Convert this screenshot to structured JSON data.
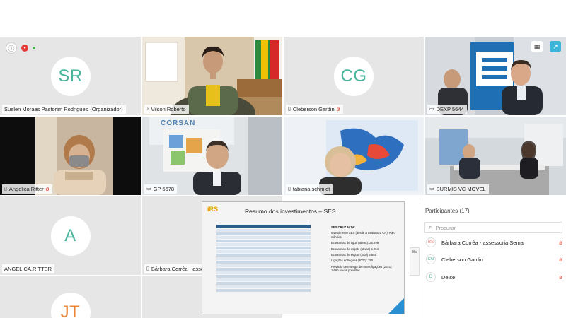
{
  "participants_grid": [
    {
      "initials": "SR",
      "name": "Suelen Moraes Pastorim Rodrigues",
      "role": "(Organizador)"
    },
    {
      "name": "Vilson Roberto"
    },
    {
      "initials": "CG",
      "name": "Cleberson Gardin"
    },
    {
      "name": "DEXP 5644"
    },
    {
      "name": "Angelica Ritter"
    },
    {
      "name": "GP 5678"
    },
    {
      "name": "fabiana.schmidt"
    },
    {
      "name": "SURMIS VC MOVEL"
    },
    {
      "initials": "A",
      "name": "ANGELICA.RITTER"
    },
    {
      "name": "Bárbara Corrêa - asses"
    },
    {
      "initials": "JT"
    }
  ],
  "wall_sign": "CORSAN",
  "slide": {
    "logo_main": "iRS",
    "title": "Resumo dos investimentos – SES",
    "heading": "SES CRUZ ALTA:",
    "lines": [
      "Investimento SES (desde a assinatura CP):  R$ 0 milhões.",
      "Economias de água (ativas): 25.299",
      "Economias de esgoto (ativas) 5.264",
      "Economias de esgoto (total) 5.655",
      "Ligações entregues (2020): 250",
      "Previsão de entrega de novas ligações (2021): 1.660 novas previstas."
    ]
  },
  "panel": {
    "title": "Participantes (17)",
    "search_placeholder": "Procurar",
    "items": [
      {
        "initials": "BS",
        "name": "Bárbara Corrêa - assessoria Sema",
        "color": "#e8736c"
      },
      {
        "initials": "CG",
        "name": "Cleberson Gardin",
        "color": "#49b59c"
      },
      {
        "initials": "D",
        "name": "Deise",
        "color": "#49b59c"
      }
    ]
  },
  "colors": {
    "accent": "#3db5d8",
    "avatar_text": "#49b59c",
    "mic_off": "#e0412f"
  }
}
